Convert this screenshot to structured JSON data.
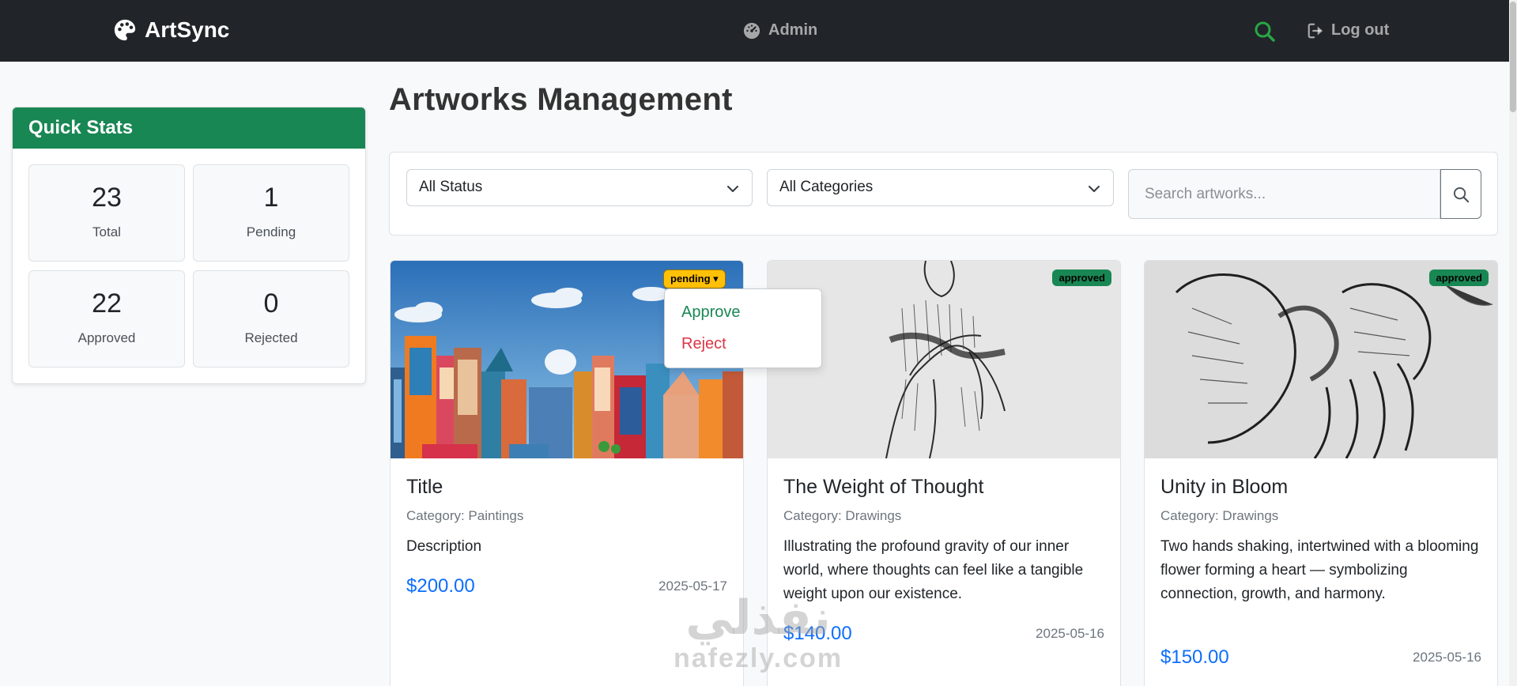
{
  "navbar": {
    "brand": "ArtSync",
    "center_link": "Admin",
    "logout_label": "Log out"
  },
  "quick_stats": {
    "title": "Quick Stats",
    "items": [
      {
        "value": "23",
        "label": "Total"
      },
      {
        "value": "1",
        "label": "Pending"
      },
      {
        "value": "22",
        "label": "Approved"
      },
      {
        "value": "0",
        "label": "Rejected"
      }
    ]
  },
  "main": {
    "title": "Artworks Management",
    "filters": {
      "status_selected": "All Status",
      "category_selected": "All Categories",
      "search_placeholder": "Search artworks..."
    },
    "artworks": [
      {
        "title": "Title",
        "category": "Category: Paintings",
        "description": "Description",
        "price": "$200.00",
        "date": "2025-05-17",
        "status": "pending"
      },
      {
        "title": "The Weight of Thought",
        "category": "Category: Drawings",
        "description": "Illustrating the profound gravity of our inner world, where thoughts can feel like a tangible weight upon our existence.",
        "price": "$140.00",
        "date": "2025-05-16",
        "status": "approved"
      },
      {
        "title": "Unity in Bloom",
        "category": "Category: Drawings",
        "description": "Two hands shaking, intertwined with a blooming flower forming a heart — symbolizing connection, growth, and harmony.",
        "price": "$150.00",
        "date": "2025-05-16",
        "status": "approved"
      }
    ],
    "status_dropdown": {
      "approve_label": "Approve",
      "reject_label": "Reject"
    }
  },
  "watermark": {
    "arabic": "نفذلي",
    "latin": "nafezly.com"
  },
  "colors": {
    "navbar_bg": "#212529",
    "success": "#198754",
    "warning": "#ffc107",
    "danger": "#dc3545",
    "primary": "#0d6efd"
  }
}
